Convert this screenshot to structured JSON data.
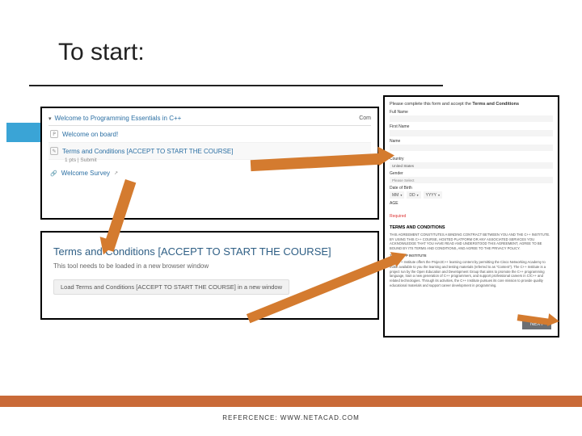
{
  "title": "To start:",
  "footer": "REFERCENCE: WWW.NETACAD.COM",
  "panel1": {
    "course_title": "Welcome to Programming Essentials in C++",
    "complete": "Com",
    "rows": {
      "welcome": "Welcome on board!",
      "terms": "Terms and Conditions [ACCEPT TO START THE COURSE]",
      "terms_sub": "1 pts | Submit",
      "survey": "Welcome Survey"
    }
  },
  "panel2": {
    "heading": "Terms and Conditions [ACCEPT TO START THE COURSE]",
    "sub": "This tool needs to be loaded in a new browser window",
    "button": "Load Terms and Conditions [ACCEPT TO START THE COURSE] in a new window"
  },
  "panel3": {
    "lead_prefix": "Please complete this form and accept the ",
    "lead_bold": "Terms and Conditions",
    "labels": {
      "full": "Full Name",
      "first": "First Name",
      "last": "Name",
      "country": "Country",
      "country_val": "United States",
      "gender": "Gender",
      "gender_val": "Please Select",
      "dob": "Date of Birth",
      "dob_mm": "MM",
      "dob_dd": "DD",
      "dob_yyyy": "YYYY",
      "age": "AGE",
      "age_req": "Required"
    },
    "terms_heading": "TERMS AND CONDITIONS",
    "body": [
      "THIS AGREEMENT CONSTITUTES A BINDING CONTRACT BETWEEN YOU AND THE C++ INSTITUTE. BY USING THIS C++ COURSE, HOSTED PLATFORM OR ANY ASSOCIATED SERVICES YOU ACKNOWLEDGE THAT YOU HAVE READ AND UNDERSTOOD THIS AGREEMENT, AGREE TO BE BOUND BY ITS TERMS AND CONDITIONS, AND AGREE TO THE PRIVACY POLICY.",
      "1. THE CPP INSTITUTE",
      "The C++ Institute offers the ProjectC++ learning content by permitting the Cisco Networking Academy to make available to you the learning and testing materials (referred to as \"Content\"). The C++ Institute is a project run by the Open Education and Development Group that aims to promote the C++ programming language, train a new generation of C++ programmers, and support professional careers in C/C++ and related technologies. Through its activities, the C++ Institute pursues its core mission to provide quality educational materials and support career development in programming."
    ],
    "next": "NEXT"
  }
}
